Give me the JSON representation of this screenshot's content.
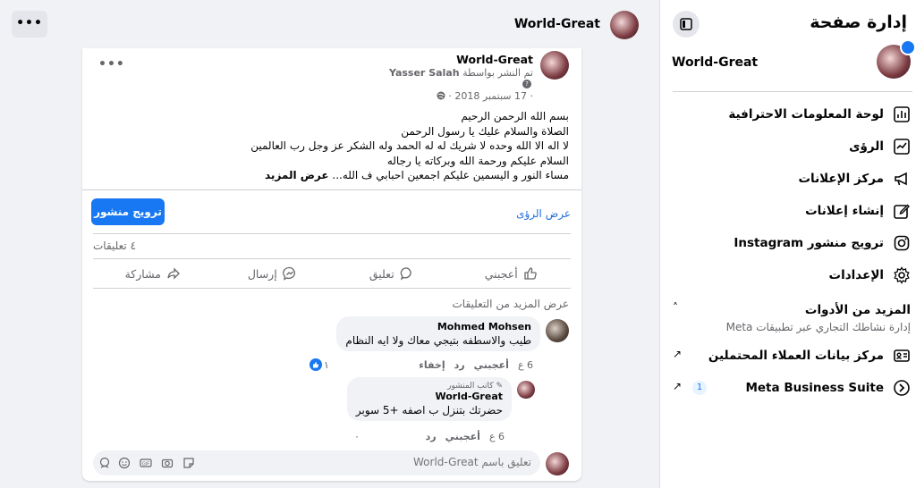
{
  "sidebar": {
    "title": "إدارة صفحة",
    "page_name": "World-Great",
    "items": [
      {
        "label": "لوحة المعلومات الاحترافية",
        "icon": "bar-chart-icon"
      },
      {
        "label": "الرؤى",
        "icon": "insights-icon"
      },
      {
        "label": "مركز الإعلانات",
        "icon": "megaphone-icon"
      },
      {
        "label": "إنشاء إعلانات",
        "icon": "pencil-icon"
      },
      {
        "label": "ترويج منشور Instagram",
        "icon": "instagram-icon"
      },
      {
        "label": "الإعدادات",
        "icon": "gear-icon"
      }
    ],
    "more_tools": {
      "title": "المزيد من الأدوات",
      "subtitle": "إدارة نشاطك التجاري عبر تطبيقات Meta"
    },
    "leads_center": "مركز بيانات العملاء المحتملين",
    "business_suite": {
      "label": "Meta Business Suite",
      "count": "1"
    }
  },
  "topbar": {
    "page_name": "World-Great",
    "menu_label": "•••"
  },
  "post": {
    "author": "World-Great",
    "byline_prefix": "تم النشر بواسطة",
    "byline_name": "Yasser Salah",
    "date": "· 17 سبتمبر 2018 ·",
    "options": "•••",
    "lines": [
      "بسم الله الرحمن الرحيم",
      "الصلاة والسلام عليك يا رسول الرحمن",
      "لا اله الا الله وحده لا شريك له له الحمد وله الشكر عز وجل رب العالمين",
      "السلام عليكم ورحمة الله وبركاته يا رجاله",
      "مساء النور و اليسمين عليكم اجمعين احبابي ف الله..."
    ],
    "see_more": "عرض المزيد",
    "insights_link": "عرض الرؤى",
    "boost_button": "ترويج منشور",
    "comments_count": "٤ تعليقات",
    "actions": {
      "like": "أعجبني",
      "comment": "تعليق",
      "send": "إرسال",
      "share": "مشاركة"
    },
    "view_more_comments": "عرض المزيد من التعليقات"
  },
  "comments": [
    {
      "author": "Mohmed Mohsen",
      "text": "طيب والاسطفه بتيجي معاك ولا ايه النظام",
      "time": "6 ع",
      "like": "أعجبني",
      "reply": "رد",
      "hide": "إخفاء",
      "reactions": "١"
    },
    {
      "author_tag": "كاتب المنشور",
      "author": "World-Great",
      "text": "حضرتك بتنزل ب اصفه +5 سوبر",
      "time": "6 ع",
      "like": "أعجبني",
      "reply": "رد",
      "reactions": "٠"
    }
  ],
  "composer": {
    "placeholder": "تعليق باسم World-Great"
  }
}
